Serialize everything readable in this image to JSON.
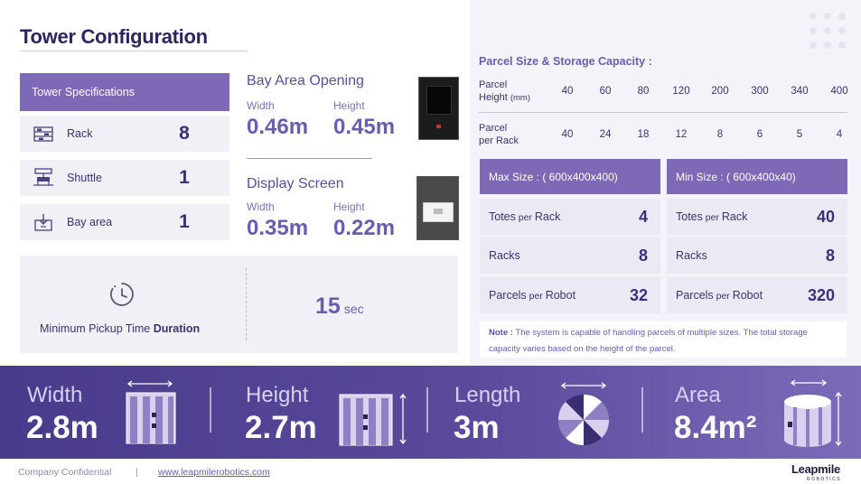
{
  "title": "Tower Configuration",
  "tower_specs": {
    "header": "Tower Specifications",
    "rows": [
      {
        "label": "Rack",
        "value": "8",
        "icon": "rack-icon"
      },
      {
        "label": "Shuttle",
        "value": "1",
        "icon": "shuttle-icon"
      },
      {
        "label": "Bay area",
        "value": "1",
        "icon": "bay-area-icon"
      }
    ]
  },
  "bay_opening": {
    "title": "Bay Area Opening",
    "width_label": "Width",
    "height_label": "Height",
    "width_value": "0.46m",
    "height_value": "0.45m"
  },
  "display_screen": {
    "title": "Display Screen",
    "width_label": "Width",
    "height_label": "Height",
    "width_value": "0.35m",
    "height_value": "0.22m"
  },
  "pickup": {
    "label_pre": "Minimum Pickup Time ",
    "label_bold": "Duration",
    "value": "15",
    "unit": "sec"
  },
  "capacity": {
    "title": "Parcel Size & Storage Capacity :",
    "height_label_1": "Parcel",
    "height_label_2": "Height",
    "height_unit": "(mm)",
    "per_rack_label_1": "Parcel",
    "per_rack_label_2": "per Rack",
    "heights": [
      "40",
      "60",
      "80",
      "120",
      "200",
      "300",
      "340",
      "400"
    ],
    "per_rack": [
      "40",
      "24",
      "18",
      "12",
      "8",
      "6",
      "5",
      "4"
    ],
    "max": {
      "header": "Max Size : ( 600x400x400)",
      "rows": [
        {
          "label": "Totes",
          "small": " per ",
          "label2": "Rack",
          "value": "4"
        },
        {
          "label": "Racks",
          "small": "",
          "label2": "",
          "value": "8"
        },
        {
          "label": "Parcels",
          "small": " per ",
          "label2": "Robot",
          "value": "32"
        }
      ]
    },
    "min": {
      "header": "Min Size : ( 600x400x40)",
      "rows": [
        {
          "label": "Totes",
          "small": " per ",
          "label2": "Rack",
          "value": "40"
        },
        {
          "label": "Racks",
          "small": "",
          "label2": "",
          "value": "8"
        },
        {
          "label": "Parcels",
          "small": " per ",
          "label2": "Robot",
          "value": "320"
        }
      ]
    },
    "note_label": "Note :",
    "note_text": " The system is capable of handling parcels of multiple sizes. The total storage capacity varies based on the height of the parcel."
  },
  "dimensions": [
    {
      "label": "Width",
      "value": "2.8m",
      "icon": "tower-width-icon"
    },
    {
      "label": "Height",
      "value": "2.7m",
      "icon": "tower-height-icon"
    },
    {
      "label": "Length",
      "value": "3m",
      "icon": "tower-top-view-icon"
    },
    {
      "label": "Area",
      "value": "8.4m²",
      "icon": "tower-area-icon"
    }
  ],
  "footer": {
    "confidential": "Company Confidential",
    "separator": "|",
    "url": "www.leapmilerobotics.com",
    "logo": "Leapmile",
    "logo_sub": "ROBOTICS"
  },
  "colors": {
    "accent": "#7d69b5",
    "dark": "#2d2460",
    "band_start": "#4a3a8c",
    "band_end": "#7b6bb8",
    "panel": "#f4f3f9"
  }
}
